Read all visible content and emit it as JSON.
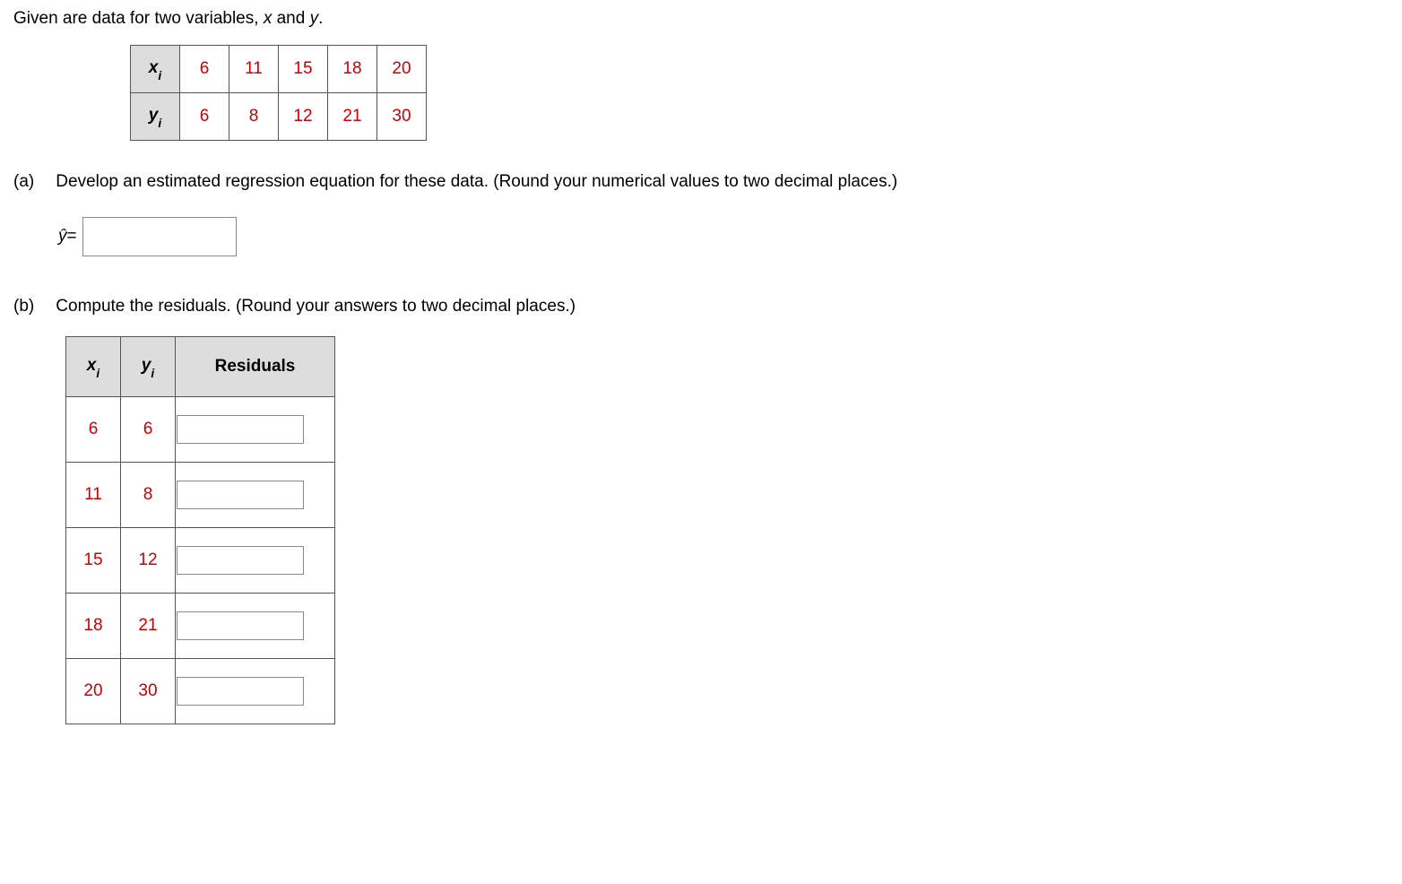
{
  "intro_prefix": "Given are data for two variables, ",
  "intro_var1": "x",
  "intro_and": " and ",
  "intro_var2": "y",
  "intro_suffix": ".",
  "row_header_x_main": "x",
  "row_header_x_sub": "i",
  "row_header_y_main": "y",
  "row_header_y_sub": "i",
  "x_values": [
    "6",
    "11",
    "15",
    "18",
    "20"
  ],
  "y_values": [
    "6",
    "8",
    "12",
    "21",
    "30"
  ],
  "part_a": {
    "label": "(a)",
    "text": "Develop an estimated regression equation for these data. (Round your numerical values to two decimal places.)",
    "yhat": "ŷ",
    "equals": " ="
  },
  "part_b": {
    "label": "(b)",
    "text": "Compute the residuals. (Round your answers to two decimal places.)",
    "col_x_main": "x",
    "col_x_sub": "i",
    "col_y_main": "y",
    "col_y_sub": "i",
    "col_res": "Residuals",
    "rows": [
      {
        "x": "6",
        "y": "6"
      },
      {
        "x": "11",
        "y": "8"
      },
      {
        "x": "15",
        "y": "12"
      },
      {
        "x": "18",
        "y": "21"
      },
      {
        "x": "20",
        "y": "30"
      }
    ]
  }
}
